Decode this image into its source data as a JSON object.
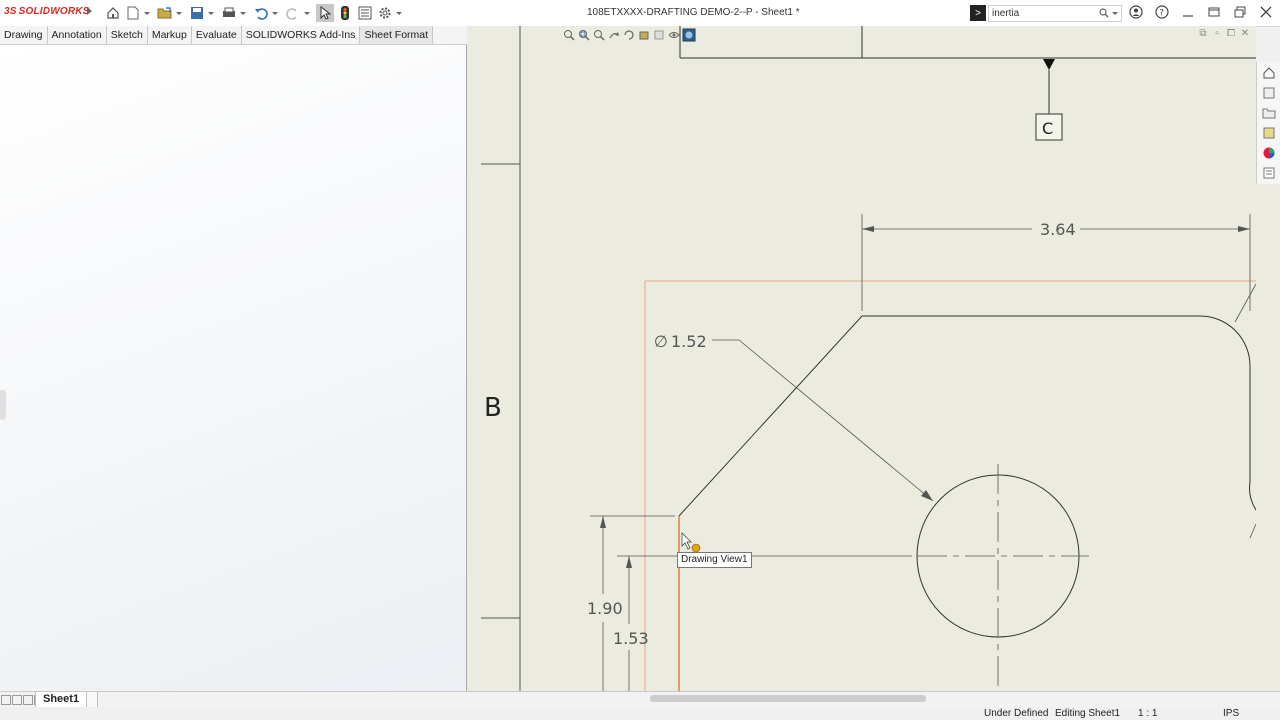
{
  "app": {
    "logo_ds": "3S",
    "logo_text": "SOLIDWORKS",
    "document_title": "108ETXXXX-DRAFTING DEMO-2--P - Sheet1 *",
    "search_value": "inertia",
    "accent_color": "#d52b1e"
  },
  "command_tabs": [
    {
      "label": "Drawing"
    },
    {
      "label": "Annotation"
    },
    {
      "label": "Sketch"
    },
    {
      "label": "Markup"
    },
    {
      "label": "Evaluate"
    },
    {
      "label": "SOLIDWORKS Add-Ins"
    },
    {
      "label": "Sheet Format"
    }
  ],
  "drawing": {
    "zone_label": "B",
    "datum_label": "C",
    "dim_width": "3.64",
    "dim_diameter": "1.52",
    "dim_diameter_symbol": "∅",
    "dim_height_1": "1.90",
    "dim_height_2": "1.53",
    "tooltip": "Drawing View1"
  },
  "sheet_tabs": [
    {
      "label": "Sheet1"
    }
  ],
  "status": {
    "state": "Under Defined",
    "editing": "Editing Sheet1",
    "scale": "1 : 1",
    "units": "IPS"
  }
}
